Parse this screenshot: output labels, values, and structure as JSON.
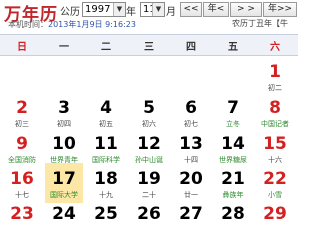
{
  "app": {
    "logo": "万年历"
  },
  "controls": {
    "year_label": "公历",
    "year_value": "1997",
    "year_unit": "年",
    "month_value": "11",
    "month_unit": "月",
    "prev_year": "<<",
    "prev_month": "年<",
    "next_month": "> >",
    "next_year": "年>>"
  },
  "info": {
    "time_prefix": "本机时间：",
    "time_value": "2013年1月9日 9:16:23",
    "lunar": "农历丁丑年【牛"
  },
  "weekdays": [
    "日",
    "一",
    "二",
    "三",
    "四",
    "五",
    "六"
  ],
  "weeks": [
    [
      {
        "day": "",
        "sub": ""
      },
      {
        "day": "",
        "sub": ""
      },
      {
        "day": "",
        "sub": ""
      },
      {
        "day": "",
        "sub": ""
      },
      {
        "day": "",
        "sub": ""
      },
      {
        "day": "",
        "sub": ""
      },
      {
        "day": "1",
        "sub": "初二"
      }
    ],
    [
      {
        "day": "2",
        "sub": "初三"
      },
      {
        "day": "3",
        "sub": "初四"
      },
      {
        "day": "4",
        "sub": "初五"
      },
      {
        "day": "5",
        "sub": "初六"
      },
      {
        "day": "6",
        "sub": "初七"
      },
      {
        "day": "7",
        "sub": "立冬"
      },
      {
        "day": "8",
        "sub": "中国记者"
      }
    ],
    [
      {
        "day": "9",
        "sub": "全国消防"
      },
      {
        "day": "10",
        "sub": "世界青年"
      },
      {
        "day": "11",
        "sub": "国际科学"
      },
      {
        "day": "12",
        "sub": "孙中山诞"
      },
      {
        "day": "13",
        "sub": "十四"
      },
      {
        "day": "14",
        "sub": "世界糖尿"
      },
      {
        "day": "15",
        "sub": "十六"
      }
    ],
    [
      {
        "day": "16",
        "sub": "十七"
      },
      {
        "day": "17",
        "sub": "国际大学"
      },
      {
        "day": "18",
        "sub": "十九"
      },
      {
        "day": "19",
        "sub": "二十"
      },
      {
        "day": "20",
        "sub": "廿一"
      },
      {
        "day": "21",
        "sub": "彝族年"
      },
      {
        "day": "22",
        "sub": "小雪"
      }
    ],
    [
      {
        "day": "23",
        "sub": ""
      },
      {
        "day": "24",
        "sub": ""
      },
      {
        "day": "25",
        "sub": ""
      },
      {
        "day": "26",
        "sub": ""
      },
      {
        "day": "27",
        "sub": ""
      },
      {
        "day": "28",
        "sub": ""
      },
      {
        "day": "29",
        "sub": ""
      }
    ]
  ],
  "highlight": {
    "week": 3,
    "col": 1
  },
  "festival_cells": [
    [
      1,
      5
    ],
    [
      1,
      6
    ],
    [
      2,
      0
    ],
    [
      2,
      1
    ],
    [
      2,
      2
    ],
    [
      2,
      3
    ],
    [
      2,
      5
    ],
    [
      3,
      1
    ],
    [
      3,
      5
    ],
    [
      3,
      6
    ]
  ],
  "colors": {
    "weekend": "#d42020",
    "festival": "#2c8a2c",
    "today_bg": "#fde7a6"
  }
}
